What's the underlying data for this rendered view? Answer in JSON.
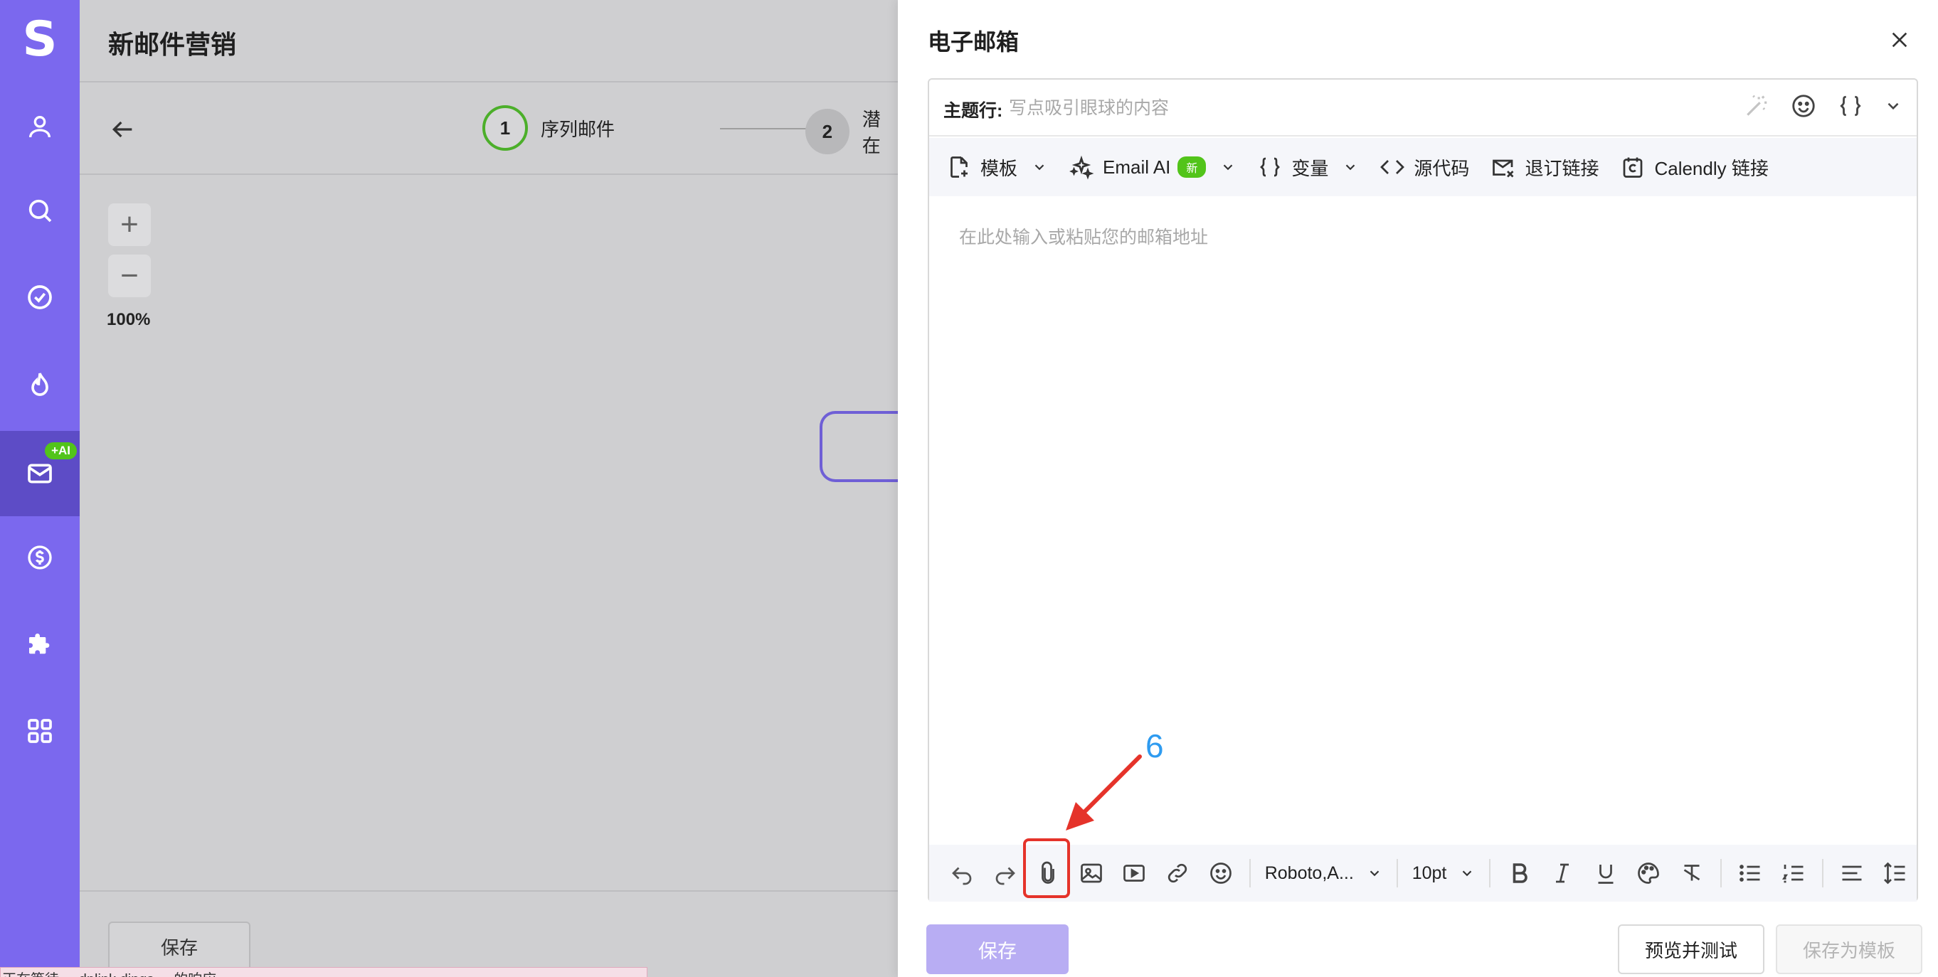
{
  "sidebar": {
    "logo": "S",
    "items": [
      {
        "name": "user-icon"
      },
      {
        "name": "search-icon"
      },
      {
        "name": "check-circle-icon"
      },
      {
        "name": "flame-icon"
      },
      {
        "name": "mail-icon",
        "badge": "+AI",
        "active": true
      },
      {
        "name": "dollar-icon"
      },
      {
        "name": "puzzle-icon"
      },
      {
        "name": "grid-icon"
      }
    ]
  },
  "background": {
    "page_title": "新邮件营销",
    "steps": [
      {
        "number": "1",
        "label": "序列邮件"
      },
      {
        "number": "2",
        "label": "潜在"
      }
    ],
    "zoom_in": "+",
    "zoom_out": "−",
    "zoom_level": "100%",
    "save_label": "保存",
    "toast_text": "正在等待 ... dplink.dings ... 的响应..."
  },
  "panel": {
    "title": "电子邮箱",
    "subject": {
      "label": "主题行:",
      "placeholder": "写点吸引眼球的内容",
      "value": ""
    },
    "toolbar_top": {
      "template": "模板",
      "email_ai": "Email AI",
      "email_ai_badge": "新",
      "variable": "变量",
      "source_code": "源代码",
      "unsubscribe": "退订链接",
      "calendly": "Calendly 链接"
    },
    "body_placeholder": "在此处输入或粘贴您的邮箱地址",
    "toolbar_bottom": {
      "font_family": "Roboto,A...",
      "font_size": "10pt"
    },
    "annotation_number": "6",
    "buttons": {
      "save": "保存",
      "preview": "预览并测试",
      "save_template": "保存为模板"
    }
  },
  "colors": {
    "sidebar": "#7b68ee",
    "sidebar_active": "#5d4cc6",
    "badge_green": "#52c41a",
    "highlight_red": "#e5332a",
    "annotation_blue": "#2e9bf0",
    "save_button": "#b8adf3"
  }
}
